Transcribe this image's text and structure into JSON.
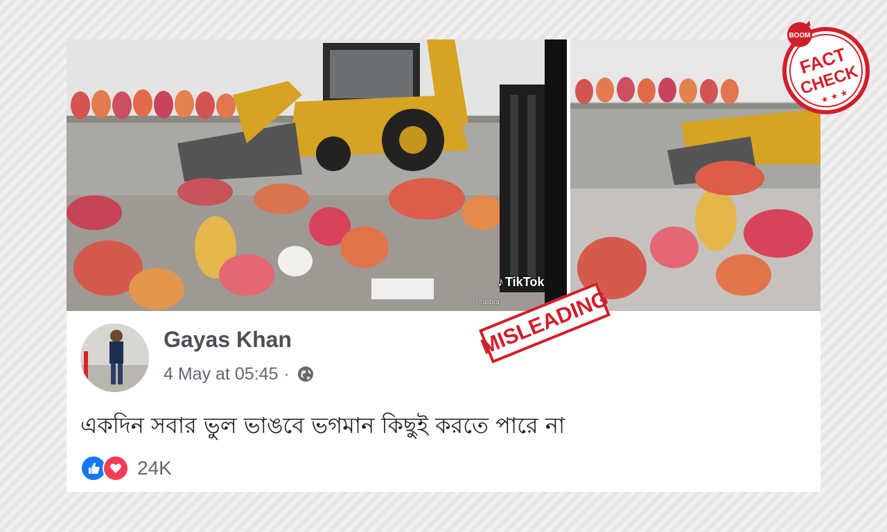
{
  "post": {
    "author": "Gayas Khan",
    "timestamp": "4 May at 05:45",
    "separator": "·",
    "text": "একদিন সবার ভুল ভাঙবে ভগমান কিছুই করতে পারে না",
    "reaction_count": "24K",
    "reactions": [
      "like-icon",
      "love-icon"
    ]
  },
  "video": {
    "watermark": "TikTok",
    "handle": "@alibra"
  },
  "stamps": {
    "misleading": "MISLEADING",
    "brand": "BOOM",
    "fact": "FACT",
    "check": "CHECK"
  },
  "colors": {
    "stamp_red": "#d11f2a",
    "like_blue": "#1877f2",
    "love_red": "#f33e58",
    "author_text": "#4b4f56",
    "meta_text": "#616770"
  }
}
